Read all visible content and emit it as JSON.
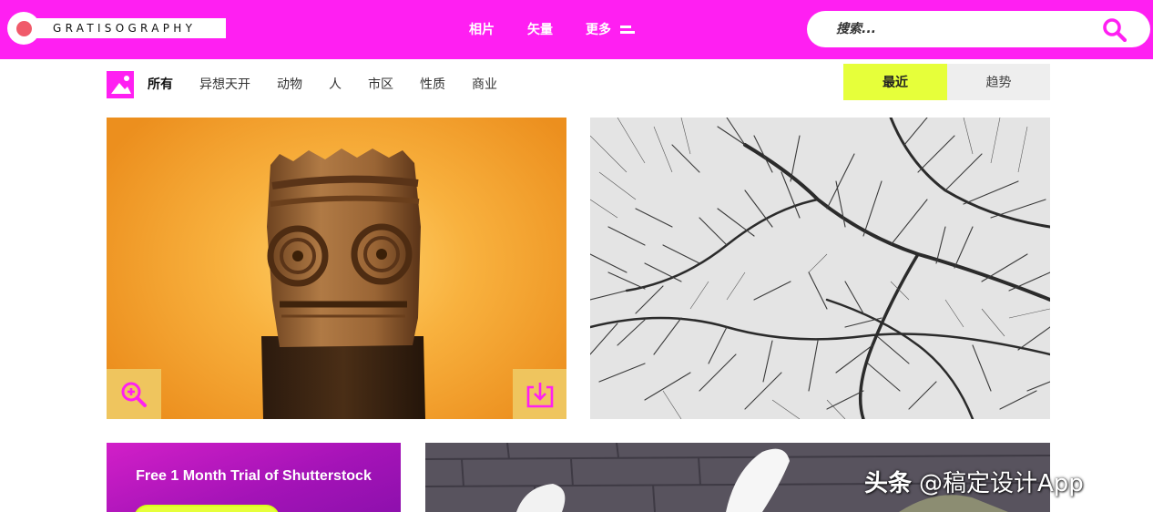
{
  "header": {
    "logo_text": "GRATISOGRAPHY",
    "nav": [
      {
        "label": "相片"
      },
      {
        "label": "矢量"
      },
      {
        "label": "更多"
      }
    ],
    "search": {
      "placeholder": "搜索..."
    }
  },
  "categories": {
    "items": [
      {
        "label": "所有",
        "active": true
      },
      {
        "label": "异想天开",
        "active": false
      },
      {
        "label": "动物",
        "active": false
      },
      {
        "label": "人",
        "active": false
      },
      {
        "label": "市区",
        "active": false
      },
      {
        "label": "性质",
        "active": false
      },
      {
        "label": "商业",
        "active": false
      }
    ]
  },
  "sort": {
    "recent_label": "最近",
    "trending_label": "趋势",
    "selected": "最近"
  },
  "promo": {
    "text": "Free 1 Month Trial of Shutterstock"
  },
  "watermark": {
    "part1": "头条",
    "part2": "@稿定设计App"
  },
  "colors": {
    "brand_magenta": "#ff1ff2",
    "accent_lime": "#e6ff3a",
    "logo_dot": "#f05a6a",
    "icon_overlay": "#efc55e",
    "promo_purple": "#a413b7"
  },
  "icons": {
    "search": "search-icon",
    "more": "menu-lines-icon",
    "category": "image-icon",
    "zoom": "zoom-in-icon",
    "download": "download-icon"
  }
}
